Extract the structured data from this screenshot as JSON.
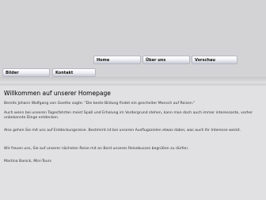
{
  "nav": {
    "home": "Home",
    "ueber_uns": "Über uns",
    "vorschau": "Vorschau",
    "bilder": "Bilder",
    "kontakt": "Kontakt"
  },
  "main": {
    "heading": "Willkommen auf unserer Homepage",
    "paragraphs": [
      "Bereits Johann Wolfgang von Goethe sagte: \"Die beste Bildung findet ein gescheiter Mensch auf Reisen.\"",
      "Auch wenn bei unseren Tagesfahrten meist Spaß und Erholung im Vordergrund stehen, kann man doch auch immer interessante, vorher unbekannte Dinge entdecken.",
      "Also gehen Sie mit uns auf Entdeckungsreise. Bestimmt ist bei unseren Ausflugszielen etwas dabei, was auch Ihr Interesse weckt.",
      "Wir freuen uns, Sie auf unserer nächsten Reise mit an Bord unseres Reisebusses begrüßen zu dürfen.",
      "Martina Banick, Mini-Tours"
    ]
  },
  "colors": {
    "page_bg": "#d3d3d5",
    "content_bg": "#e1e1e3",
    "nav_bg": "#f2f2f6",
    "text": "#333333"
  }
}
